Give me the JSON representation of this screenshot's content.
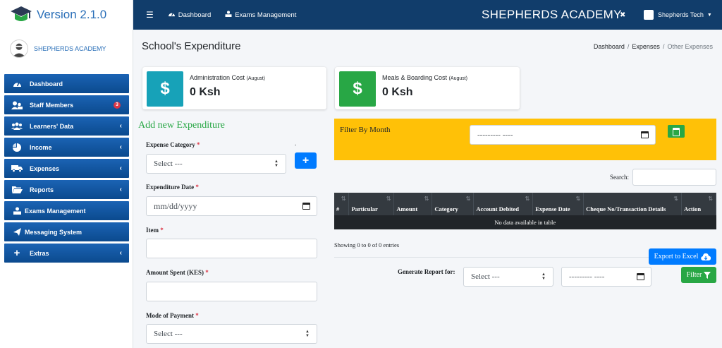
{
  "sidebar": {
    "version": "Version 2.1.0",
    "user": "SHEPHERDS ACADEMY",
    "items": [
      {
        "label": "Dashboard",
        "icon": "tachometer-icon"
      },
      {
        "label": "Staff Members",
        "icon": "users-icon",
        "badge": "3"
      },
      {
        "label": "Learners' Data",
        "icon": "group-icon"
      },
      {
        "label": "Income",
        "icon": "pie-chart-icon"
      },
      {
        "label": "Expenses",
        "icon": "truck-icon"
      },
      {
        "label": "Reports",
        "icon": "folder-icon"
      },
      {
        "label": "Exams Management",
        "icon": "exam-icon"
      },
      {
        "label": "Messaging System",
        "icon": "paper-plane-icon"
      },
      {
        "label": "Extras",
        "icon": "plus-icon"
      }
    ]
  },
  "topbar": {
    "dashboard": "Dashboard",
    "exams": "Exams Management",
    "school": "SHEPHERDS ACADEMY",
    "account": "Shepherds Tech"
  },
  "page": {
    "title": "School's Expenditure",
    "crumbs": [
      "Dashboard",
      "Expenses",
      "Other Expenses"
    ]
  },
  "cards": [
    {
      "label": "Administration Cost",
      "period": "(August)",
      "value": "0 Ksh",
      "color": "#17a2b8"
    },
    {
      "label": "Meals & Boarding Cost",
      "period": "(August)",
      "value": "0 Ksh",
      "color": "#28a745"
    }
  ],
  "form": {
    "title": "Add new Expenditure",
    "category_label": "Expense Category",
    "category_value": "Select ---",
    "date_label": "Expenditure Date",
    "date_placeholder": "mm/dd/yyyy",
    "item_label": "Item",
    "amount_label": "Amount Spent (KES)",
    "payment_label": "Mode of Payment",
    "payment_value": "Select ---",
    "req": "*",
    "dot": "."
  },
  "filter": {
    "title": "Filter By Month",
    "month_placeholder": "--------- ----"
  },
  "table": {
    "search_label": "Search:",
    "headers": [
      "#",
      "Particular",
      "Amount",
      "Category",
      "Account Debited",
      "Expense Date",
      "Cheque No/Transaction Details",
      "Action"
    ],
    "empty": "No data available in table",
    "showing": "Showing 0 to 0 of 0 entries"
  },
  "report": {
    "export": "Export to Excel",
    "label": "Generate Report for:",
    "select_value": "Select ---",
    "month_placeholder": "--------- ----",
    "filter": "Filter"
  }
}
